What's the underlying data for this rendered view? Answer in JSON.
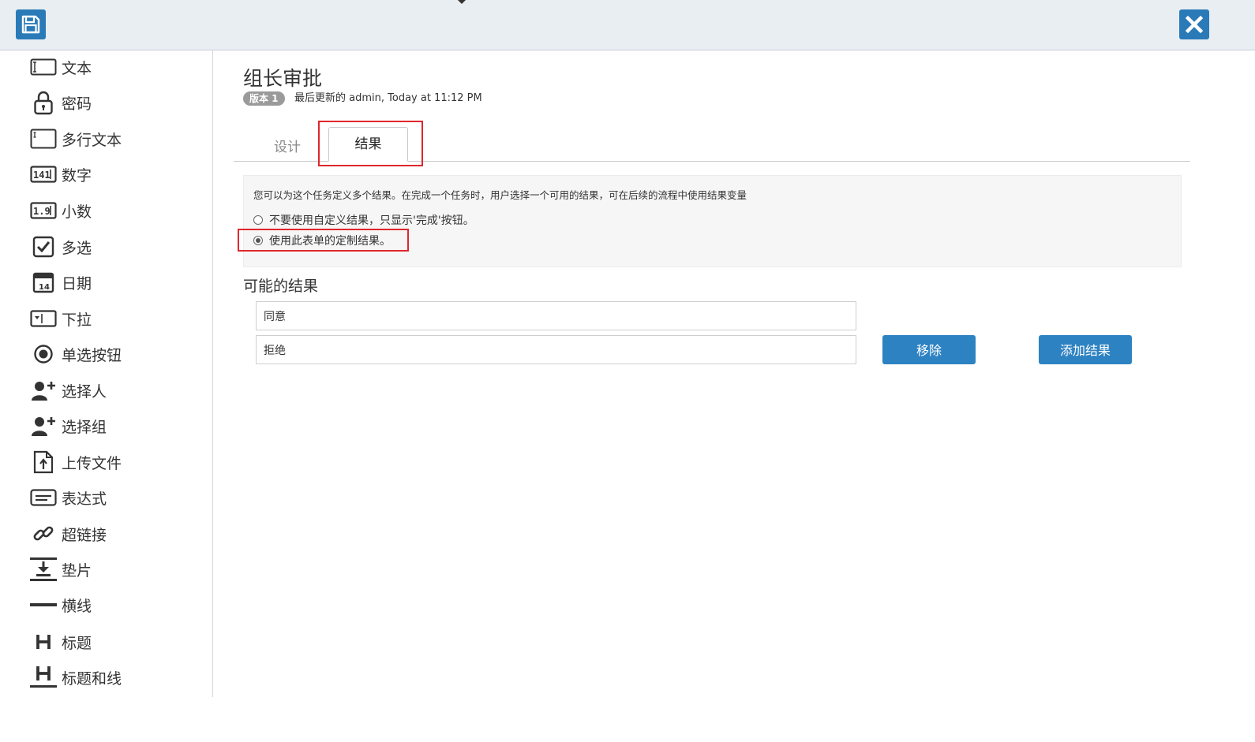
{
  "toolbar": {
    "save_icon": "save-icon",
    "close_icon": "close-icon"
  },
  "palette": {
    "items": [
      {
        "label": "文本",
        "icon": "text-field-icon"
      },
      {
        "label": "密码",
        "icon": "lock-icon"
      },
      {
        "label": "多行文本",
        "icon": "textarea-icon"
      },
      {
        "label": "数字",
        "icon": "number-icon"
      },
      {
        "label": "小数",
        "icon": "decimal-icon"
      },
      {
        "label": "多选",
        "icon": "checkbox-icon"
      },
      {
        "label": "日期",
        "icon": "calendar-icon"
      },
      {
        "label": "下拉",
        "icon": "dropdown-icon"
      },
      {
        "label": "单选按钮",
        "icon": "radio-icon"
      },
      {
        "label": "选择人",
        "icon": "add-user-icon"
      },
      {
        "label": "选择组",
        "icon": "add-group-icon"
      },
      {
        "label": "上传文件",
        "icon": "upload-file-icon"
      },
      {
        "label": "表达式",
        "icon": "expression-icon"
      },
      {
        "label": "超链接",
        "icon": "link-icon"
      },
      {
        "label": "垫片",
        "icon": "spacer-icon"
      },
      {
        "label": "横线",
        "icon": "horizontal-line-icon"
      },
      {
        "label": "标题",
        "icon": "heading-icon"
      },
      {
        "label": "标题和线",
        "icon": "heading-line-icon"
      }
    ]
  },
  "form": {
    "title": "组长审批",
    "version_badge": "版本 1",
    "last_updated": "最后更新的 admin, Today at 11:12 PM"
  },
  "tabs": [
    {
      "label": "设计",
      "active": false
    },
    {
      "label": "结果",
      "active": true
    }
  ],
  "outcomes": {
    "info_text": "您可以为这个任务定义多个结果。在完成一个任务时，用户选择一个可用的结果，可在后续的流程中使用结果变量",
    "options": [
      {
        "label": "不要使用自定义结果，只显示'完成'按钮。",
        "checked": false
      },
      {
        "label": "使用此表单的定制结果。",
        "checked": true
      }
    ],
    "section_title": "可能的结果",
    "values": [
      "同意",
      "拒绝"
    ],
    "remove_label": "移除",
    "add_label": "添加结果"
  },
  "colors": {
    "accent": "#2d82c2",
    "highlight": "#e0262c",
    "topbar": "#e9eef2"
  }
}
